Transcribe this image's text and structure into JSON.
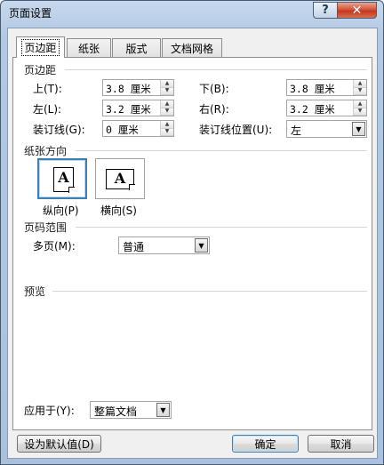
{
  "window": {
    "title": "页面设置"
  },
  "tabs": [
    {
      "label": "页边距"
    },
    {
      "label": "纸张"
    },
    {
      "label": "版式"
    },
    {
      "label": "文档网格"
    }
  ],
  "margins": {
    "heading": "页边距",
    "top": {
      "label": "上(T):",
      "value": "3.8 厘米"
    },
    "bottom": {
      "label": "下(B):",
      "value": "3.8 厘米"
    },
    "left": {
      "label": "左(L):",
      "value": "3.2 厘米"
    },
    "right": {
      "label": "右(R):",
      "value": "3.2 厘米"
    },
    "gutter": {
      "label": "装订线(G):",
      "value": "0 厘米"
    },
    "gutter_position": {
      "label": "装订线位置(U):",
      "value": "左"
    }
  },
  "orientation": {
    "heading": "纸张方向",
    "glyph": "A",
    "portrait_label": "纵向(P)",
    "landscape_label": "横向(S)",
    "selected": "portrait"
  },
  "pages": {
    "heading": "页码范围",
    "multiple_label": "多页(M):",
    "multiple_value": "普通"
  },
  "preview": {
    "heading": "预览",
    "apply_label": "应用于(Y):",
    "apply_value": "整篇文档"
  },
  "buttons": {
    "default": "设为默认值(D)",
    "ok": "确定",
    "cancel": "取消"
  },
  "colors": {
    "accent": "#3c7fb1",
    "close": "#c4371c"
  }
}
